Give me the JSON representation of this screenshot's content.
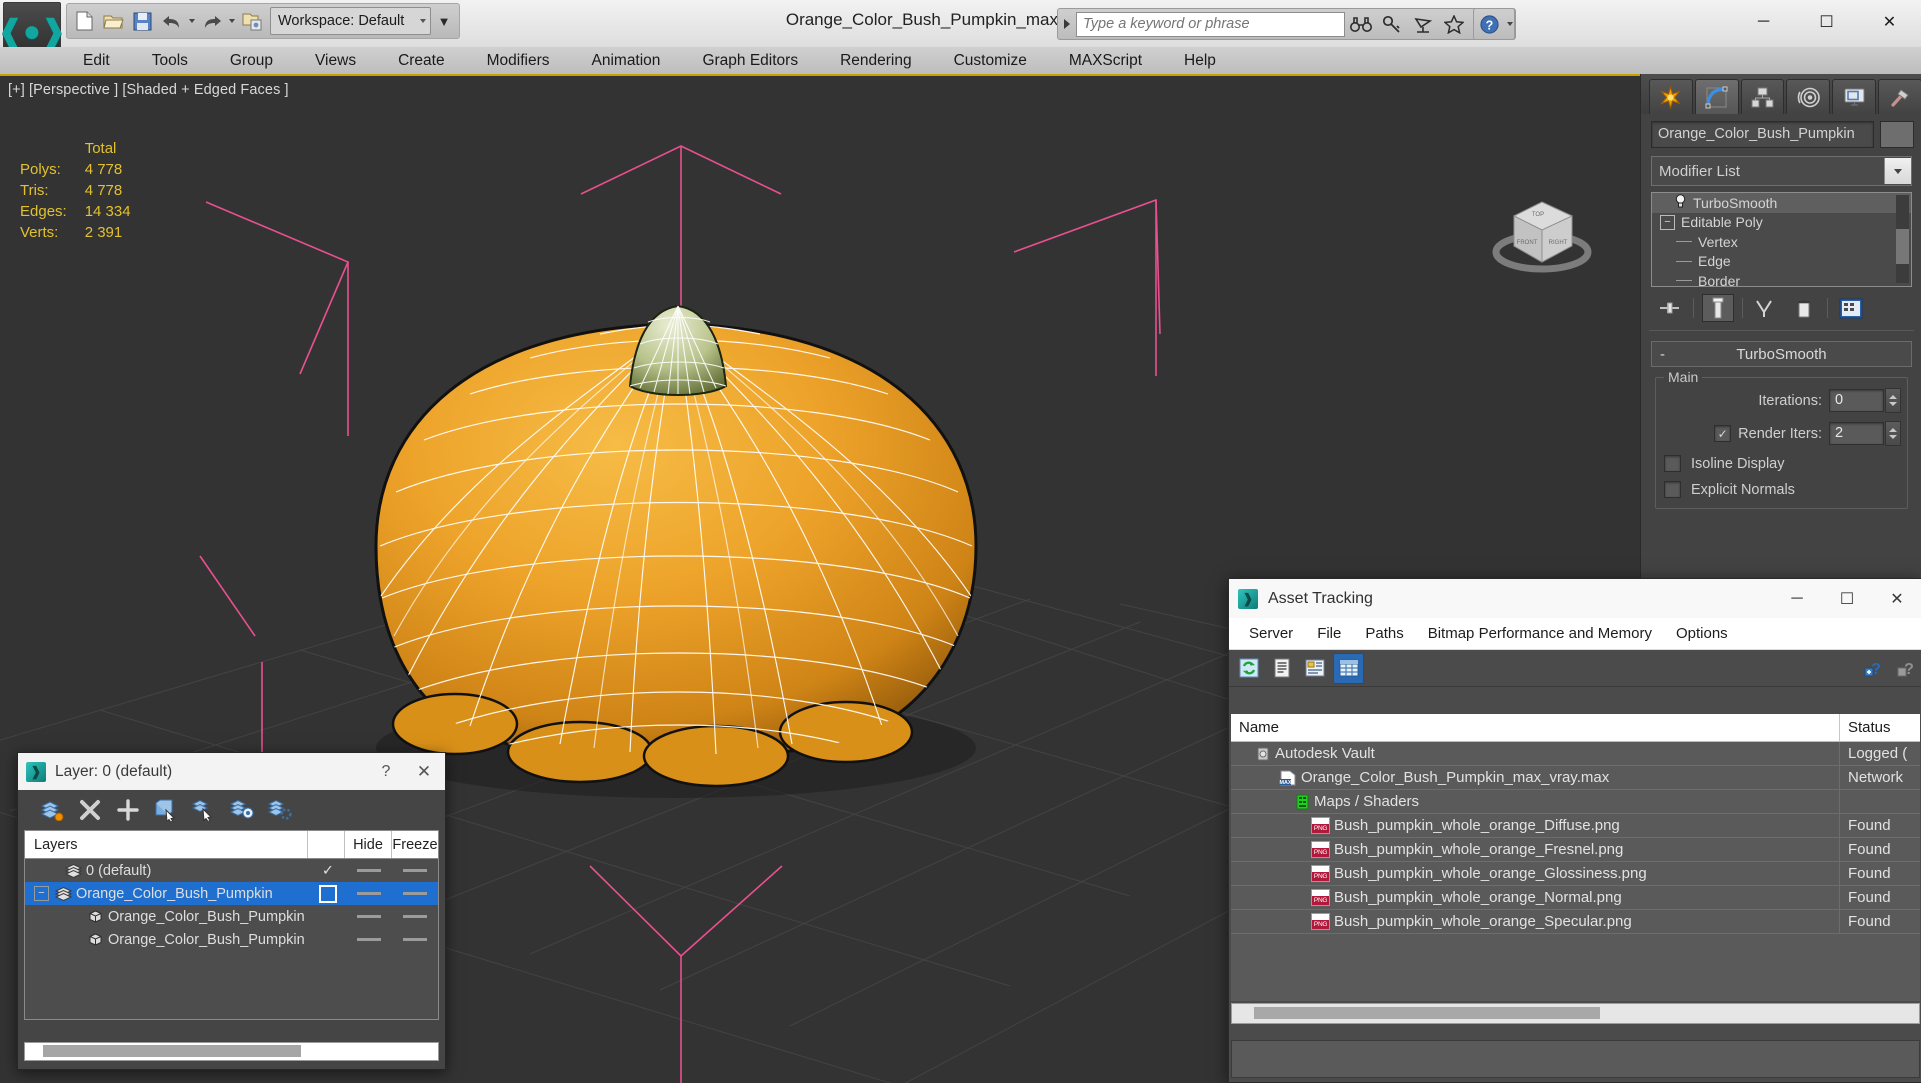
{
  "titlebar": {
    "app_icon": "3dsmax-logo-icon",
    "workspace": "Workspace: Default",
    "document_title": "Orange_Color_Bush_Pumpkin_max_vray.max",
    "search_placeholder": "Type a keyword or phrase",
    "quick_access": [
      {
        "name": "new-file-button",
        "icon": "new-file-icon"
      },
      {
        "name": "open-file-button",
        "icon": "open-folder-icon"
      },
      {
        "name": "save-file-button",
        "icon": "save-disk-icon"
      },
      {
        "name": "undo-button",
        "icon": "undo-arrow-icon"
      },
      {
        "name": "redo-button",
        "icon": "redo-arrow-icon"
      },
      {
        "name": "set-project-folder-button",
        "icon": "project-folder-icon"
      }
    ],
    "search_tools": [
      {
        "name": "search-binoculars-button",
        "icon": "binoculars-icon"
      },
      {
        "name": "search-key-button",
        "icon": "key-icon"
      },
      {
        "name": "communication-center-button",
        "icon": "satellite-dish-icon"
      },
      {
        "name": "favorites-button",
        "icon": "star-icon"
      },
      {
        "name": "help-button",
        "icon": "question-circle-icon"
      }
    ],
    "window_controls": {
      "minimize": "─",
      "maximize": "☐",
      "close": "✕"
    }
  },
  "menubar": {
    "items": [
      "Edit",
      "Tools",
      "Group",
      "Views",
      "Create",
      "Modifiers",
      "Animation",
      "Graph Editors",
      "Rendering",
      "Customize",
      "MAXScript",
      "Help"
    ]
  },
  "viewport": {
    "label": "[+] [Perspective ] [Shaded + Edged Faces ]",
    "stats": {
      "column_header": "Total",
      "rows": [
        {
          "label": "Polys:",
          "value": "4 778"
        },
        {
          "label": "Tris:",
          "value": "4 778"
        },
        {
          "label": "Edges:",
          "value": "14 334"
        },
        {
          "label": "Verts:",
          "value": "2 391"
        }
      ]
    },
    "viewcube": {
      "name": "view-cube",
      "faces": {
        "top": "TOP",
        "front": "FRONT",
        "right": "RIGHT"
      }
    }
  },
  "command_panel": {
    "tabs": [
      {
        "name": "tab-create",
        "icon": "create-star-icon",
        "active": false
      },
      {
        "name": "tab-modify",
        "icon": "modify-curve-icon",
        "active": true
      },
      {
        "name": "tab-hierarchy",
        "icon": "hierarchy-icon",
        "active": false
      },
      {
        "name": "tab-motion",
        "icon": "motion-wheel-icon",
        "active": false
      },
      {
        "name": "tab-display",
        "icon": "display-monitor-icon",
        "active": false
      },
      {
        "name": "tab-utilities",
        "icon": "hammer-icon",
        "active": false
      }
    ],
    "object_name": "Orange_Color_Bush_Pumpkin",
    "modifier_list_label": "Modifier List",
    "stack": [
      {
        "label": "TurboSmooth",
        "selected": true,
        "icon": "light-bulb-icon",
        "indent": 1
      },
      {
        "label": "Editable Poly",
        "selected": false,
        "icon": "expand-minus-icon",
        "indent": 0
      },
      {
        "label": "Vertex",
        "selected": false,
        "icon": "sub-object-dash",
        "indent": 2
      },
      {
        "label": "Edge",
        "selected": false,
        "icon": "sub-object-dash",
        "indent": 2
      },
      {
        "label": "Border",
        "selected": false,
        "icon": "sub-object-dash",
        "indent": 2
      }
    ],
    "stack_buttons": [
      {
        "name": "pin-stack-button",
        "icon": "pin-icon"
      },
      {
        "name": "show-end-result-button",
        "icon": "show-end-result-icon",
        "active": true
      },
      {
        "name": "make-unique-button",
        "icon": "make-unique-icon"
      },
      {
        "name": "remove-modifier-button",
        "icon": "trash-bin-icon"
      },
      {
        "name": "configure-modifier-sets-button",
        "icon": "configure-sets-icon"
      }
    ],
    "rollout": {
      "title": "TurboSmooth",
      "collapse_glyph": "-",
      "group_caption": "Main",
      "iterations_label": "Iterations:",
      "iterations_value": "0",
      "render_iters_label": "Render Iters:",
      "render_iters_value": "2",
      "render_iters_checked": true,
      "isoline_display_label": "Isoline Display",
      "isoline_display_checked": false,
      "explicit_normals_label": "Explicit Normals",
      "explicit_normals_checked": false
    }
  },
  "layer_dialog": {
    "title": "Layer: 0 (default)",
    "help_glyph": "?",
    "close_glyph": "✕",
    "toolbar": [
      {
        "name": "create-new-layer-button",
        "icon": "new-layer-icon"
      },
      {
        "name": "delete-layer-button",
        "icon": "delete-x-icon"
      },
      {
        "name": "add-layer-button",
        "icon": "plus-icon"
      },
      {
        "name": "select-objects-in-layer-button",
        "icon": "select-objects-layer-icon"
      },
      {
        "name": "select-highlighted-objects-button",
        "icon": "select-highlighted-icon"
      },
      {
        "name": "highlight-selected-objects-button",
        "icon": "highlight-selected-icon"
      },
      {
        "name": "layer-properties-button",
        "icon": "layer-settings-icon"
      }
    ],
    "columns": {
      "name": "Layers",
      "hide": "Hide",
      "freeze": "Freeze"
    },
    "rows": [
      {
        "label": "0 (default)",
        "indent": 1,
        "selected": false,
        "expandable": false,
        "current": true,
        "icon": "layer-stack-icon"
      },
      {
        "label": "Orange_Color_Bush_Pumpkin",
        "indent": 0,
        "selected": true,
        "expandable": true,
        "expand_glyph": "−",
        "current": false,
        "icon": "layer-stack-icon"
      },
      {
        "label": "Orange_Color_Bush_Pumpkin",
        "indent": 2,
        "selected": false,
        "expandable": false,
        "current": false,
        "icon": "object-box-icon"
      },
      {
        "label": "Orange_Color_Bush_Pumpkin",
        "indent": 2,
        "selected": false,
        "expandable": false,
        "current": false,
        "icon": "object-box-icon"
      }
    ]
  },
  "asset_tracking": {
    "title": "Asset Tracking",
    "window_controls": {
      "minimize": "─",
      "maximize": "☐",
      "close": "✕"
    },
    "menu": [
      "Server",
      "File",
      "Paths",
      "Bitmap Performance and Memory",
      "Options"
    ],
    "toolbar": [
      {
        "name": "refresh-button",
        "icon": "refresh-green-icon",
        "active": false
      },
      {
        "name": "list-view-button",
        "icon": "list-lines-icon",
        "active": false
      },
      {
        "name": "detail-view-button",
        "icon": "detail-view-icon",
        "active": false
      },
      {
        "name": "grid-view-button",
        "icon": "grid-table-icon",
        "active": true
      }
    ],
    "toolbar_right": [
      {
        "name": "check-in-help-button",
        "icon": "question-blue-icon"
      },
      {
        "name": "check-out-help-button",
        "icon": "question-grey-icon"
      }
    ],
    "columns": {
      "name": "Name",
      "status": "Status"
    },
    "rows": [
      {
        "name": "Autodesk Vault",
        "status": "Logged (",
        "indent": 1,
        "icon": "vault-icon"
      },
      {
        "name": "Orange_Color_Bush_Pumpkin_max_vray.max",
        "status": "Network",
        "indent": 2,
        "icon": "max-file-icon"
      },
      {
        "name": "Maps / Shaders",
        "status": "",
        "indent": 3,
        "icon": "maps-shaders-icon"
      },
      {
        "name": "Bush_pumpkin_whole_orange_Diffuse.png",
        "status": "Found",
        "indent": 4,
        "icon": "png-icon"
      },
      {
        "name": "Bush_pumpkin_whole_orange_Fresnel.png",
        "status": "Found",
        "indent": 4,
        "icon": "png-icon"
      },
      {
        "name": "Bush_pumpkin_whole_orange_Glossiness.png",
        "status": "Found",
        "indent": 4,
        "icon": "png-icon"
      },
      {
        "name": "Bush_pumpkin_whole_orange_Normal.png",
        "status": "Found",
        "indent": 4,
        "icon": "png-icon"
      },
      {
        "name": "Bush_pumpkin_whole_orange_Specular.png",
        "status": "Found",
        "indent": 4,
        "icon": "png-icon"
      }
    ]
  },
  "colors": {
    "accent_blue": "#1f6fd0",
    "stats_yellow": "#e2c12e",
    "viewport_bg": "#333333",
    "pumpkin_orange": "#e8a020",
    "helper_pink": "#e8508f"
  }
}
